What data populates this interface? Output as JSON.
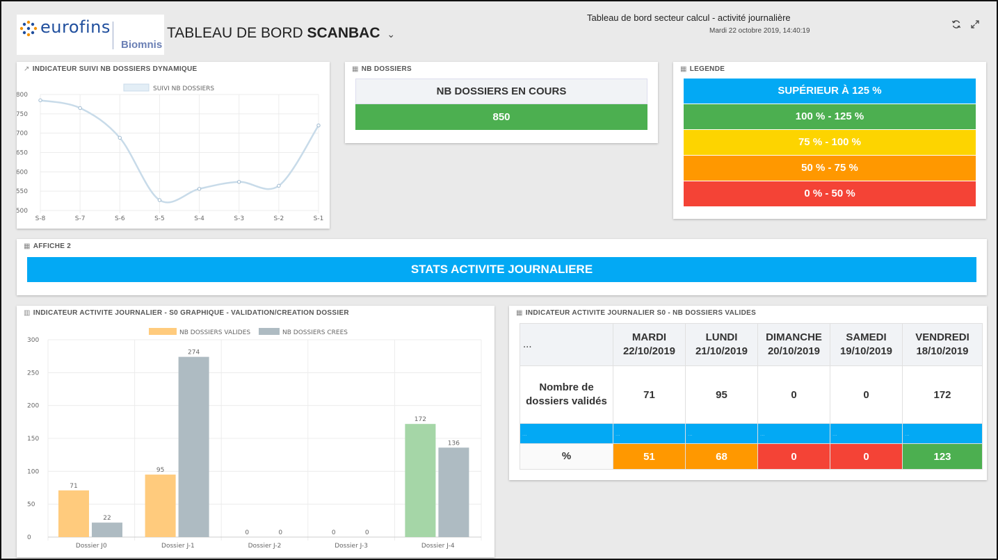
{
  "header": {
    "logo_text": "eurofins",
    "logo_sub": "Biomnis",
    "dashboard_title_prefix": "TABLEAU DE BORD",
    "dashboard_title_bold": "SCANBAC",
    "chevron": "⌄",
    "title": "Tableau de bord secteur calcul - activité journalière",
    "datetime": "Mardi 22 octobre 2019, 14:40:19",
    "refresh_icon": "refresh-icon",
    "fullscreen_icon": "fullscreen-icon"
  },
  "panels": {
    "suivi": {
      "title": "INDICATEUR SUIVI NB DOSSIERS DYNAMIQUE",
      "icon": "line-chart-icon"
    },
    "nb_dossiers": {
      "title": "NB DOSSIERS",
      "icon": "table-icon",
      "header": "NB DOSSIERS EN COURS",
      "value": "850",
      "value_color": "#4caf50"
    },
    "legende": {
      "title": "LEGENDE",
      "icon": "table-icon",
      "rows": [
        {
          "label": "SUPÉRIEUR À 125 %",
          "color": "#03a9f4"
        },
        {
          "label": "100 % - 125 %",
          "color": "#4caf50"
        },
        {
          "label": "75 % - 100 %",
          "color": "#fdd400"
        },
        {
          "label": "50 % - 75 %",
          "color": "#ff9800"
        },
        {
          "label": "0 % - 50 %",
          "color": "#f44336"
        }
      ]
    },
    "affiche": {
      "title": "AFFICHE 2",
      "icon": "table-icon",
      "banner": "STATS ACTIVITE JOURNALIERE",
      "banner_color": "#03a9f4"
    },
    "activite_graph": {
      "title": "INDICATEUR ACTIVITE JOURNALIER - S0 GRAPHIQUE - VALIDATION/CREATION DOSSIER",
      "icon": "bar-chart-icon"
    },
    "activite_table": {
      "title": "INDICATEUR ACTIVITE JOURNALIER S0 - NB DOSSIERS VALIDES",
      "icon": "table-icon",
      "corner": "...",
      "columns": [
        {
          "day": "MARDI",
          "date": "22/10/2019"
        },
        {
          "day": "LUNDI",
          "date": "21/10/2019"
        },
        {
          "day": "DIMANCHE",
          "date": "20/10/2019"
        },
        {
          "day": "SAMEDI",
          "date": "19/10/2019"
        },
        {
          "day": "VENDREDI",
          "date": "18/10/2019"
        }
      ],
      "row_label": "Nombre de dossiers validés",
      "values": [
        "71",
        "95",
        "0",
        "0",
        "172"
      ],
      "blue_row_text": "...",
      "pct_label": "%",
      "pct_values": [
        "51",
        "68",
        "0",
        "0",
        "123"
      ],
      "pct_colors": [
        "#ff9800",
        "#ff9800",
        "#f44336",
        "#f44336",
        "#4caf50"
      ]
    }
  },
  "chart_data": [
    {
      "type": "line",
      "legend": [
        "SUIVI NB DOSSIERS"
      ],
      "categories": [
        "S-8",
        "S-7",
        "S-6",
        "S-5",
        "S-4",
        "S-3",
        "S-2",
        "S-1"
      ],
      "series": [
        {
          "name": "SUIVI NB DOSSIERS",
          "values": [
            785,
            765,
            688,
            527,
            556,
            574,
            564,
            720
          ]
        }
      ],
      "yticks": [
        500,
        550,
        600,
        650,
        700,
        750,
        800
      ],
      "ylim": [
        500,
        800
      ],
      "color": "#c8dbe9",
      "grid": true,
      "legend_position": "top"
    },
    {
      "type": "bar",
      "categories": [
        "Dossier J0",
        "Dossier J-1",
        "Dossier J-2",
        "Dossier J-3",
        "Dossier J-4"
      ],
      "series": [
        {
          "name": "NB DOSSIERS VALIDES",
          "values": [
            71,
            95,
            0,
            0,
            172
          ],
          "color": "#ffcb7d",
          "colors": [
            "#ffcb7d",
            "#ffcb7d",
            "#ffcb7d",
            "#ffcb7d",
            "#a5d6a7"
          ]
        },
        {
          "name": "NB DOSSIERS CREES",
          "values": [
            22,
            274,
            0,
            0,
            136
          ],
          "color": "#aebbc2"
        }
      ],
      "yticks": [
        0,
        50,
        100,
        150,
        200,
        250,
        300
      ],
      "ylim": [
        0,
        300
      ],
      "grid": true,
      "legend_position": "top"
    }
  ]
}
